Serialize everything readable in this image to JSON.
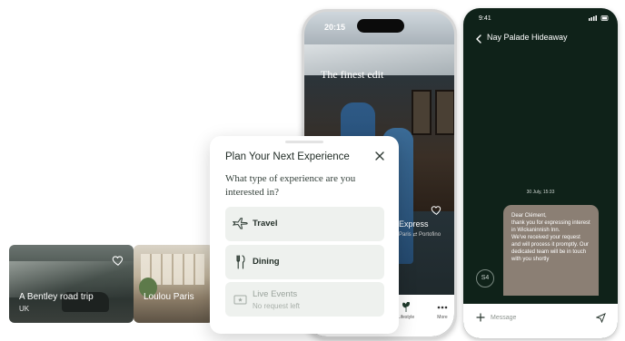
{
  "cards": [
    {
      "title": "A Bentley road trip",
      "subtitle": "UK"
    },
    {
      "title": "Loulou Paris",
      "subtitle": ""
    }
  ],
  "phone": {
    "time": "20:15",
    "headline": "The finest edit",
    "feature_title": "Express",
    "feature_subtitle": "Paris ⇄ Portofino",
    "tabs": [
      {
        "label": "Lifestyle",
        "icon": "plant-icon"
      },
      {
        "label": "More",
        "icon": "dots-icon"
      }
    ]
  },
  "modal": {
    "title": "Plan Your Next Experience",
    "question": "What type of experience are you interested in?",
    "options": [
      {
        "label": "Travel",
        "sublabel": "",
        "icon": "airplane-icon",
        "enabled": true
      },
      {
        "label": "Dining",
        "sublabel": "",
        "icon": "cutlery-icon",
        "enabled": true
      },
      {
        "label": "Live Events",
        "sublabel": "No request left",
        "icon": "ticket-icon",
        "enabled": false
      }
    ]
  },
  "chat": {
    "time": "9:41",
    "title": "Nay Palade Hideaway",
    "date": "30 July, 15:33",
    "message": "Dear Clément,\nthank you for expressing interest in Wickaninnish Inn.\nWe've received your request and will process it promptly. Our dedicated team will be in touch with you shortly",
    "avatar": "S4",
    "placeholder": "Message"
  },
  "colors": {
    "chat_bg": "#0f2219",
    "bubble": "#8b7f74",
    "option_bg": "#eef1ee"
  }
}
